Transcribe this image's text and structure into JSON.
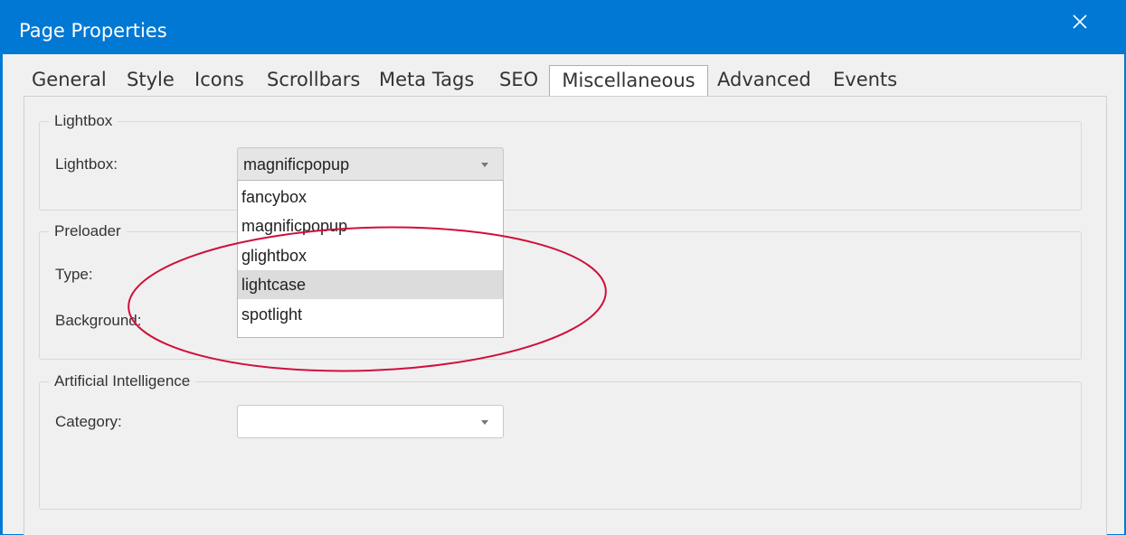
{
  "window": {
    "title": "Page Properties"
  },
  "tabs": [
    {
      "label": "General"
    },
    {
      "label": "Style"
    },
    {
      "label": "Icons"
    },
    {
      "label": "Scrollbars"
    },
    {
      "label": "Meta Tags"
    },
    {
      "label": "SEO"
    },
    {
      "label": "Miscellaneous"
    },
    {
      "label": "Advanced"
    },
    {
      "label": "Events"
    }
  ],
  "lightbox": {
    "legend": "Lightbox",
    "label": "Lightbox:",
    "selected": "magnificpopup",
    "options": [
      "fancybox",
      "magnificpopup",
      "glightbox",
      "lightcase",
      "spotlight"
    ],
    "highlighted": "lightcase"
  },
  "preloader": {
    "legend": "Preloader",
    "type_label": "Type:",
    "background_label": "Background:"
  },
  "ai": {
    "legend": "Artificial Intelligence",
    "category_label": "Category:",
    "category_value": ""
  },
  "annotation": {
    "color": "#d0103a",
    "shape": "ellipse"
  }
}
